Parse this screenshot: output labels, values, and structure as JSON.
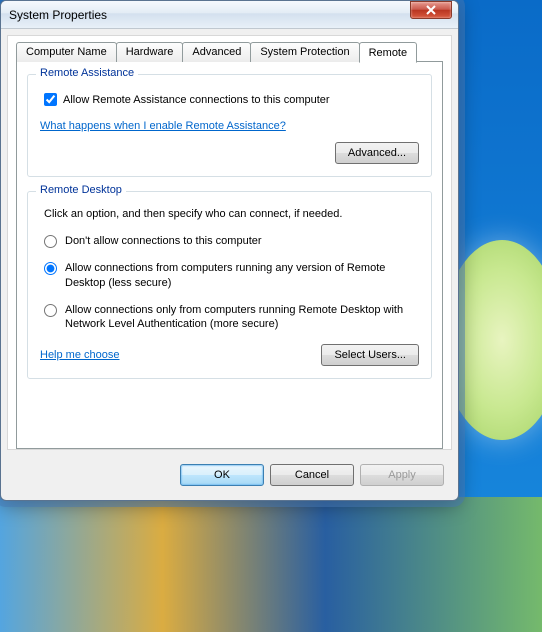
{
  "window": {
    "title": "System Properties"
  },
  "tabs": {
    "computer_name": "Computer Name",
    "hardware": "Hardware",
    "advanced": "Advanced",
    "system_protection": "System Protection",
    "remote": "Remote",
    "active": "remote"
  },
  "remote_assistance": {
    "group_title": "Remote Assistance",
    "checkbox_label": "Allow Remote Assistance connections to this computer",
    "checkbox_checked": true,
    "help_link": "What happens when I enable Remote Assistance?",
    "advanced_button": "Advanced..."
  },
  "remote_desktop": {
    "group_title": "Remote Desktop",
    "instruction": "Click an option, and then specify who can connect, if needed.",
    "options": {
      "dont_allow": "Don't allow connections to this computer",
      "any_version": "Allow connections from computers running any version of Remote Desktop (less secure)",
      "nla_only": "Allow connections only from computers running Remote Desktop with Network Level Authentication (more secure)"
    },
    "selected": "any_version",
    "help_link": "Help me choose",
    "select_users_button": "Select Users..."
  },
  "buttons": {
    "ok": "OK",
    "cancel": "Cancel",
    "apply": "Apply"
  }
}
